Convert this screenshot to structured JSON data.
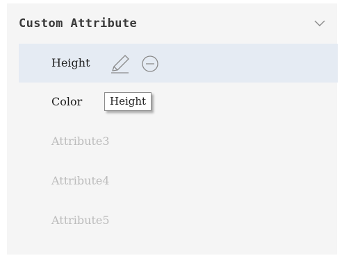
{
  "panel": {
    "title": "Custom Attribute",
    "collapse_icon": "chevron-down-icon",
    "attributes": [
      {
        "label": "Height",
        "state": "selected"
      },
      {
        "label": "Color",
        "state": "normal"
      },
      {
        "label": "Attribute3",
        "state": "disabled"
      },
      {
        "label": "Attribute4",
        "state": "disabled"
      },
      {
        "label": "Attribute5",
        "state": "disabled"
      }
    ],
    "row_actions": {
      "edit_icon": "pencil-icon",
      "remove_icon": "minus-circle-icon"
    },
    "tooltip": "Height"
  },
  "colors": {
    "panel_background": "#f5f5f5",
    "selected_row_background": "#e5ebf3",
    "text": "#1e1e1e",
    "disabled_text": "#bcbcbc",
    "icon_stroke": "#8a8a8a"
  }
}
